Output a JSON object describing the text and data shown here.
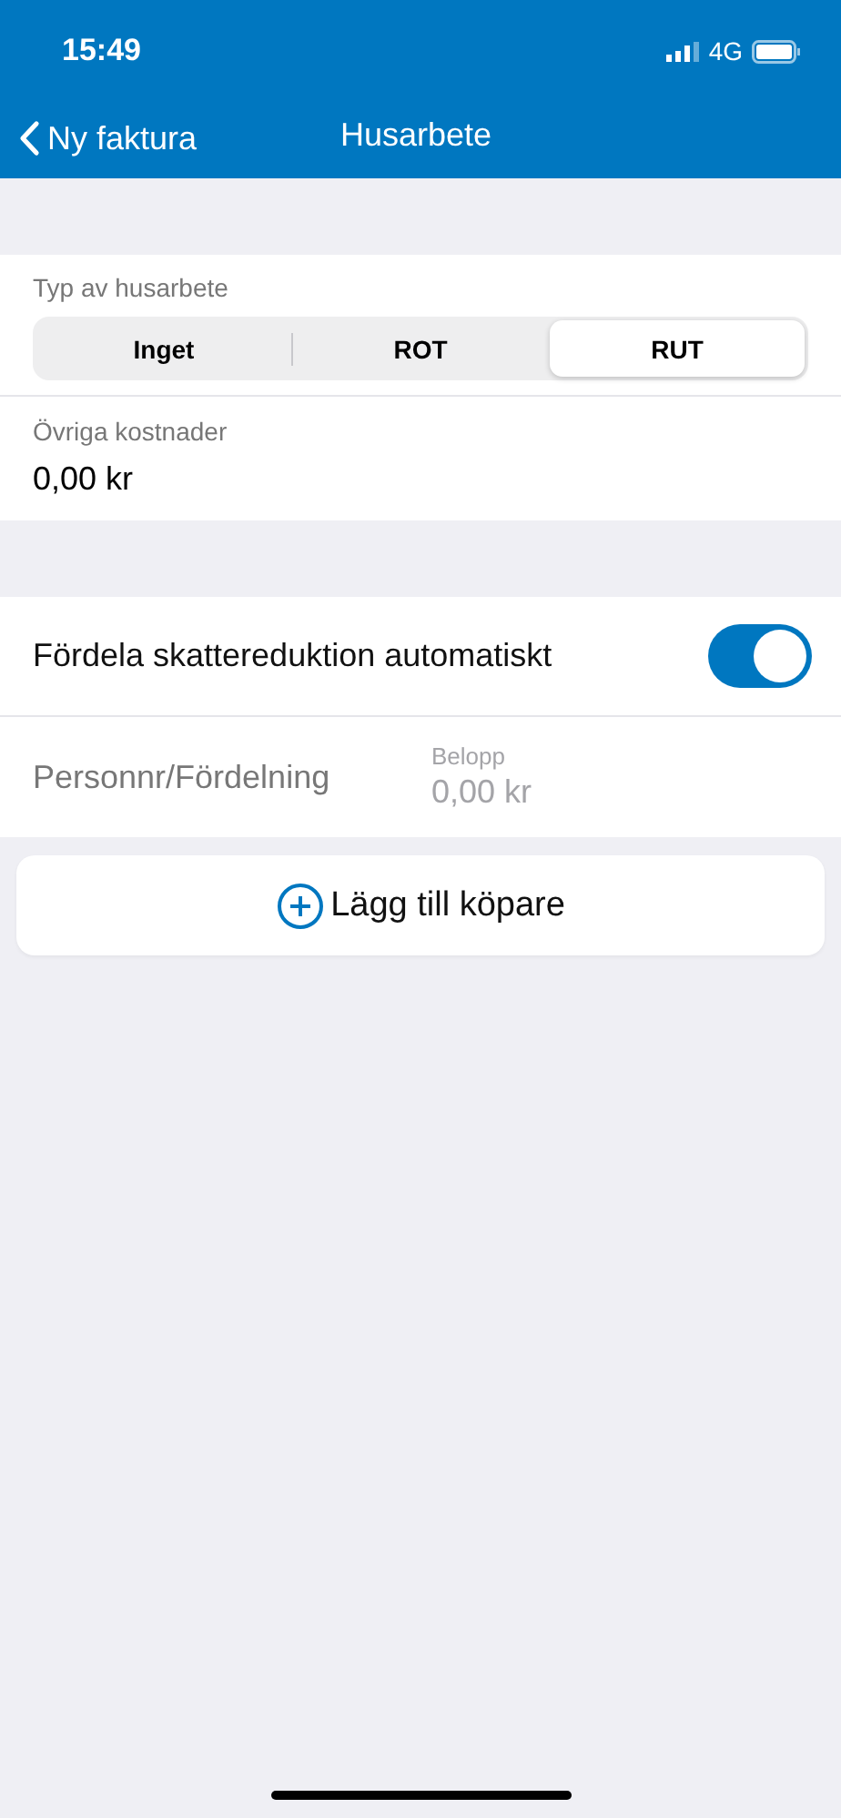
{
  "status_bar": {
    "time": "15:49",
    "network": "4G"
  },
  "nav": {
    "back": "Ny faktura",
    "title": "Husarbete"
  },
  "work_type": {
    "label": "Typ av husarbete",
    "options": [
      {
        "label": "Inget",
        "selected": false
      },
      {
        "label": "ROT",
        "selected": false
      },
      {
        "label": "RUT",
        "selected": true
      }
    ]
  },
  "other_costs": {
    "label": "Övriga kostnader",
    "value": "0,00 kr"
  },
  "auto_split": {
    "label": "Fördela skattereduktion automatiskt",
    "on": true
  },
  "buyer_row": {
    "label": "Personnr/Fördelning",
    "amount_label": "Belopp",
    "amount_placeholder": "0,00 kr"
  },
  "add_buyer": {
    "label": "Lägg till köpare"
  }
}
